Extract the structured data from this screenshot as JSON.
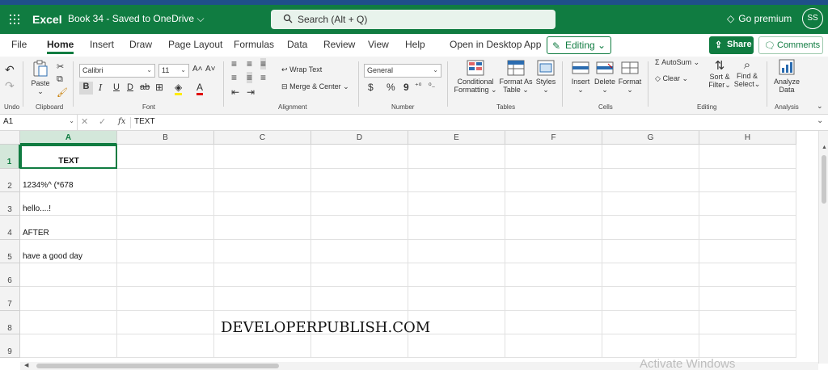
{
  "app": {
    "name": "Excel",
    "doc_title": "Book 34  -  Saved to OneDrive",
    "doc_chevron": "⌵",
    "search_placeholder": "Search (Alt + Q)",
    "premium_label": "Go premium",
    "avatar_initials": "SS"
  },
  "menu_tabs": [
    {
      "label": "File"
    },
    {
      "label": "Home"
    },
    {
      "label": "Insert"
    },
    {
      "label": "Draw"
    },
    {
      "label": "Page Layout"
    },
    {
      "label": "Formulas"
    },
    {
      "label": "Data"
    },
    {
      "label": "Review"
    },
    {
      "label": "View"
    },
    {
      "label": "Help"
    },
    {
      "label": "Open in Desktop App"
    }
  ],
  "editing_label": "Editing",
  "share_label": "Share",
  "comments_label": "Comments",
  "ribbon": {
    "undo_group": "Undo",
    "clipboard": {
      "paste": "Paste",
      "group": "Clipboard"
    },
    "font": {
      "name": "Calibri",
      "size": "11",
      "group": "Font",
      "bold": "B",
      "italic": "I",
      "underline": "U",
      "double_underline": "D",
      "strike": "ab",
      "grow": "A˄",
      "shrink": "A˅",
      "font_color": "A"
    },
    "alignment": {
      "wrap": "Wrap Text",
      "merge": "Merge & Center",
      "group": "Alignment"
    },
    "number": {
      "format": "General",
      "group": "Number",
      "currency": "$",
      "percent": "%",
      "comma": "9"
    },
    "tables": {
      "conditional": "Conditional",
      "conditional2": "Formatting",
      "format_as": "Format As",
      "format_as2": "Table",
      "styles": "Styles",
      "group": "Tables"
    },
    "cells": {
      "insert": "Insert",
      "delete": "Delete",
      "format": "Format",
      "group": "Cells"
    },
    "editing": {
      "autosum": "AutoSum",
      "clear": "Clear",
      "sort": "Sort &",
      "sort2": "Filter",
      "find": "Find &",
      "find2": "Select",
      "group": "Editing"
    },
    "analysis": {
      "analyze": "Analyze",
      "analyze2": "Data",
      "group": "Analysis"
    }
  },
  "formula_bar": {
    "name_box": "A1",
    "fx": "fx",
    "content": "TEXT"
  },
  "sheet": {
    "columns": [
      "A",
      "B",
      "C",
      "D",
      "E",
      "F",
      "G",
      "H"
    ],
    "rows": [
      "1",
      "2",
      "3",
      "4",
      "5",
      "6",
      "7",
      "8",
      "9"
    ],
    "cells": {
      "A1": "TEXT",
      "A2": "1234%^  (*678",
      "A3": "hello....!",
      "A4": "AFTER",
      "A5": "have a good day"
    },
    "active_cell": "A1"
  },
  "overlay": {
    "watermark": "DEVELOPERPUBLISH.COM",
    "activate": "Activate Windows"
  }
}
